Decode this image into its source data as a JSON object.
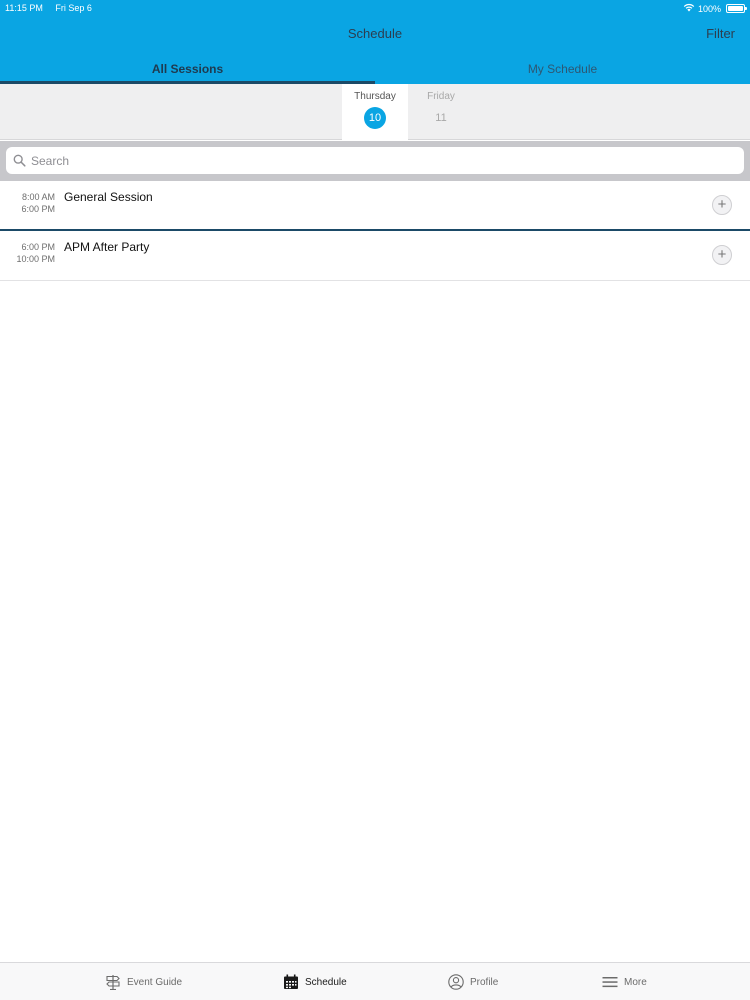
{
  "status_bar": {
    "time": "11:15 PM",
    "date": "Fri Sep 6",
    "battery": "100%"
  },
  "nav": {
    "title": "Schedule",
    "filter_label": "Filter"
  },
  "segments": [
    {
      "label": "All Sessions",
      "active": true
    },
    {
      "label": "My Schedule",
      "active": false
    }
  ],
  "days": [
    {
      "name": "Thursday",
      "number": "10",
      "selected": true
    },
    {
      "name": "Friday",
      "number": "11",
      "selected": false
    }
  ],
  "search": {
    "placeholder": "Search",
    "value": ""
  },
  "sessions": [
    {
      "start": "8:00 AM",
      "end": "6:00 PM",
      "title": "General Session"
    },
    {
      "start": "6:00 PM",
      "end": "10:00 PM",
      "title": "APM After Party"
    }
  ],
  "tab_bar": {
    "items": [
      {
        "label": "Event Guide",
        "icon": "signpost-icon",
        "active": false
      },
      {
        "label": "Schedule",
        "icon": "calendar-icon",
        "active": true
      },
      {
        "label": "Profile",
        "icon": "profile-icon",
        "active": false
      },
      {
        "label": "More",
        "icon": "menu-icon",
        "active": false
      }
    ]
  },
  "colors": {
    "accent": "#0aa5e3",
    "dark_accent": "#1b4a67",
    "strip_bg": "#efeff0",
    "search_bg": "#c7c7cb"
  }
}
